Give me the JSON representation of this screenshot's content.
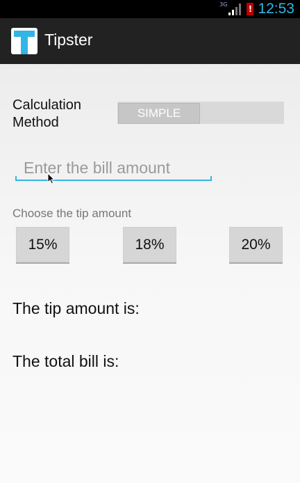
{
  "status": {
    "network": "3G",
    "time": "12:53"
  },
  "app": {
    "title": "Tipster"
  },
  "form": {
    "calc_method_label": "Calculation Method",
    "calc_method_toggle": "SIMPLE",
    "bill_placeholder": "Enter the bill amount",
    "bill_value": "",
    "tip_choice_label": "Choose the tip amount",
    "tip_options": [
      "15%",
      "18%",
      "20%"
    ]
  },
  "results": {
    "tip_label": "The tip amount is:",
    "total_label": "The total bill is:"
  },
  "colors": {
    "accent": "#33b5e5",
    "actionbar": "#222222"
  }
}
